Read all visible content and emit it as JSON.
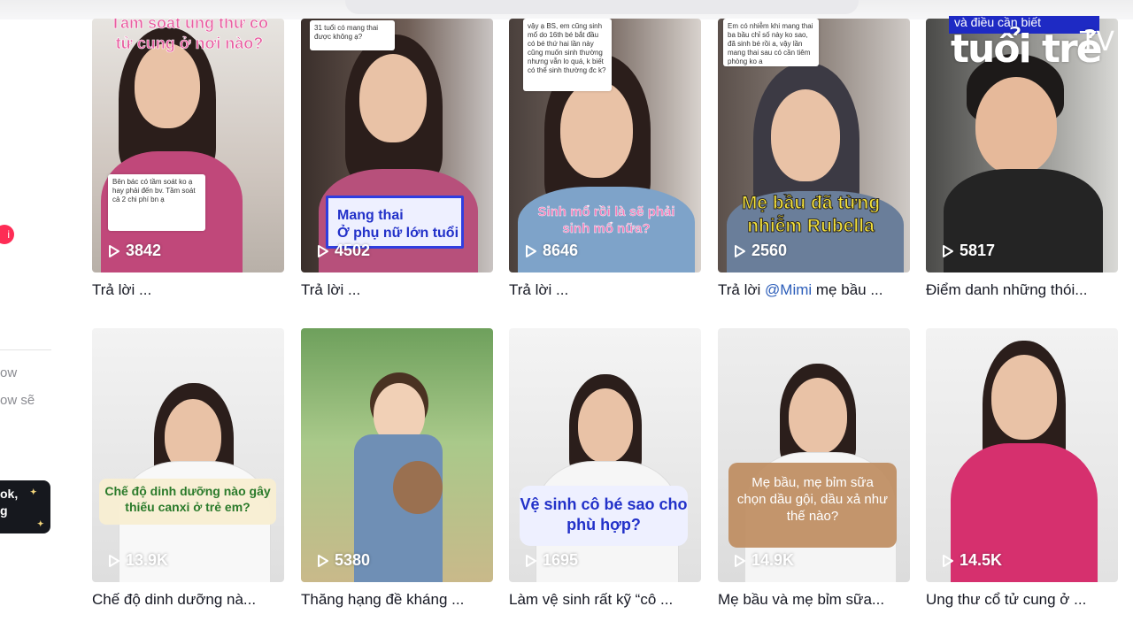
{
  "sidebar": {
    "badge": "i",
    "text_1": "ow",
    "text_2": "ow sẽ",
    "promo": [
      "ok,",
      "g"
    ]
  },
  "logo": {
    "brand": "tuổi trẻ",
    "tv": "TV",
    "tagline": "và điều cần biết"
  },
  "videos": [
    {
      "views": "3842",
      "caption": "Trả lời ...",
      "overlay": "Tầm soát ung thư cổ tử cung ở nơi nào?",
      "comment": "Bên bác có tầm soát ko ạ hay phải đến bv. Tầm soát cả 2 chi phí bn ạ"
    },
    {
      "views": "4502",
      "caption": "Trả lời ...",
      "overlay": "Mang thai\nỞ phụ nữ lớn tuổi",
      "comment": "31 tuổi có mang thai được không ạ?"
    },
    {
      "views": "8646",
      "caption": "Trả lời ...",
      "overlay": "Sinh mổ rồi là sẽ phải sinh mổ nữa?",
      "comment": "vậy ạ BS, em cũng sinh mổ do 16th bé bắt đầu có bé thứ hai lần này cũng muốn sinh thường nhưng vẫn lo quá, k biết có thể sinh thường đc k?"
    },
    {
      "views": "2560",
      "caption_prefix": "Trả lời ",
      "caption_mention": "@Mimi",
      "caption_suffix": " mẹ bầu ...",
      "overlay": "Mẹ bầu đã từng nhiễm Rubella",
      "comment": "Em có nhiễm khi mang thai ba bầu chỉ số này ko sao, đã sinh bé rồi a, vậy lần mang thai sau có cần tiêm phòng ko a"
    },
    {
      "views": "5817",
      "caption": "Điểm danh những thói..."
    },
    {
      "views": "13.9K",
      "caption": "Chế độ dinh dưỡng nà...",
      "overlay": "Chế độ dinh dưỡng nào gây thiếu canxi ở trẻ em?"
    },
    {
      "views": "5380",
      "caption": "Thăng hạng đề kháng ..."
    },
    {
      "views": "1695",
      "caption": "Làm vệ sinh rất kỹ “cô ...",
      "overlay": "Vệ sinh cô bé sao cho phù hợp?"
    },
    {
      "views": "14.9K",
      "caption": "Mẹ bầu và mẹ bỉm sữa...",
      "overlay": "Mẹ bầu, mẹ bỉm sữa chọn dầu gội, dầu xả như thế nào?"
    },
    {
      "views": "14.5K",
      "caption": "Ung thư cổ tử cung ở ..."
    }
  ]
}
